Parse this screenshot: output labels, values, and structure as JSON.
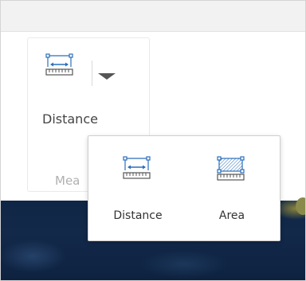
{
  "toolbar": {
    "measure_button": {
      "label": "Distance",
      "icon": "ruler-distance-icon"
    },
    "dropdown_icon": "caret-down-icon",
    "group_label": "Mea"
  },
  "menu": {
    "items": [
      {
        "label": "Distance",
        "icon": "ruler-distance-icon"
      },
      {
        "label": "Area",
        "icon": "ruler-area-icon"
      }
    ]
  },
  "colors": {
    "icon_blue": "#2a6ebb",
    "icon_gray": "#555555",
    "map_dark": "#13294a"
  }
}
